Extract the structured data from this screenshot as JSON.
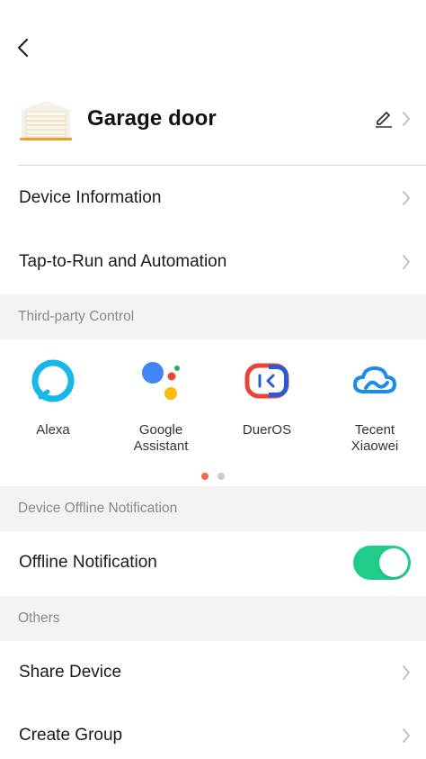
{
  "nav": {
    "back_icon": "chevron-left-icon"
  },
  "device": {
    "name": "Garage door",
    "edit_icon": "pencil-icon",
    "thumbnail_icon": "garage-door-icon"
  },
  "rows": {
    "device_information": "Device Information",
    "tap_to_run": "Tap-to-Run and Automation"
  },
  "third_party": {
    "section_title": "Third-party Control",
    "items": [
      {
        "label": "Alexa",
        "icon": "alexa-icon"
      },
      {
        "label": "Google\nAssistant",
        "icon": "google-assistant-icon"
      },
      {
        "label": "DuerOS",
        "icon": "dueros-icon"
      },
      {
        "label": "Tecent\nXiaowei",
        "icon": "tencent-xiaowei-icon"
      }
    ],
    "page_index": 0,
    "page_count": 2
  },
  "offline": {
    "section_title": "Device Offline Notification",
    "label": "Offline Notification",
    "enabled": true
  },
  "others": {
    "section_title": "Others",
    "share": "Share Device",
    "create_group": "Create Group"
  },
  "colors": {
    "toggle_on": "#1fcc8a",
    "dot_active": "#f26a4b",
    "dot_inactive": "#cccccc",
    "alexa": "#16b8e8",
    "dueros_red": "#e9433d",
    "dueros_blue": "#2a5bd7",
    "tencent": "#1a8cf0",
    "google_blue": "#4285f4",
    "google_red": "#ea4335",
    "google_yellow": "#fbbc05",
    "google_green": "#34a853",
    "garage_orange": "#f39a2b"
  }
}
